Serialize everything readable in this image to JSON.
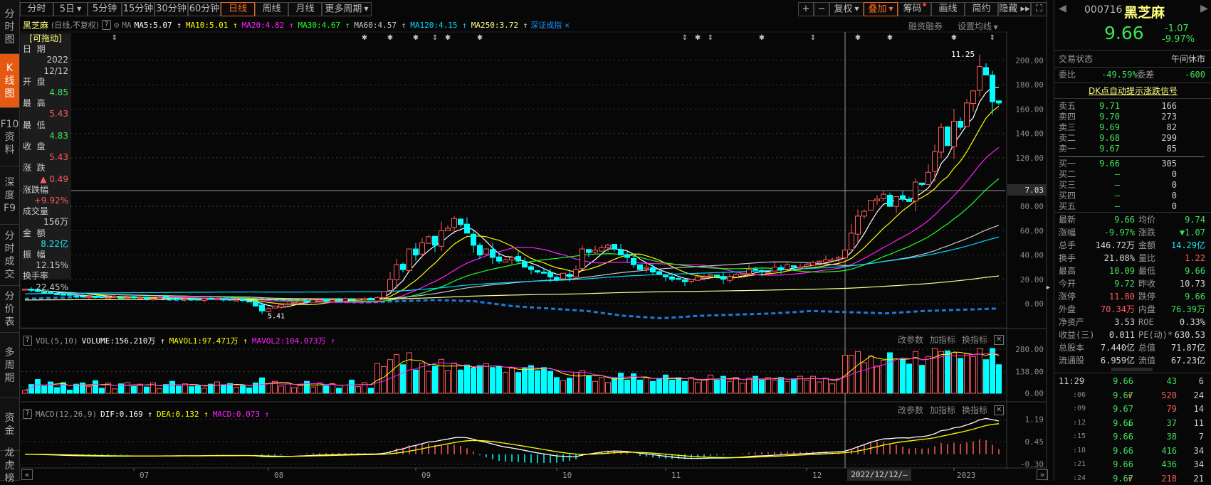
{
  "sidebar": {
    "items": [
      {
        "label": "分\n时\n图",
        "active": false
      },
      {
        "label": "K\n线\n图",
        "active": true
      },
      {
        "label": "F10\n资\n料",
        "active": false
      },
      {
        "label": "深\n度\nF9",
        "active": false
      },
      {
        "label": "分\n时\n成\n交",
        "active": false
      },
      {
        "label": "分\n价\n表",
        "active": false
      },
      {
        "label": "多\n周\n期",
        "active": false
      },
      {
        "label": "资\n金",
        "active": false
      },
      {
        "label": "龙\n虎\n榜",
        "active": false
      }
    ]
  },
  "toolbar": {
    "periods": [
      {
        "label": "分时"
      },
      {
        "label": "5日",
        "dropdown": true
      },
      {
        "label": "5分钟"
      },
      {
        "label": "15分钟"
      },
      {
        "label": "30分钟"
      },
      {
        "label": "60分钟"
      },
      {
        "label": "日线",
        "active": true
      },
      {
        "label": "周线"
      },
      {
        "label": "月线"
      },
      {
        "label": "更多周期",
        "dropdown": true
      }
    ],
    "tools": [
      {
        "label": "+"
      },
      {
        "label": "−"
      },
      {
        "label": "复权",
        "dropdown": true
      },
      {
        "label": "叠加",
        "dropdown": true,
        "active": true
      },
      {
        "label": "筹码",
        "dot": true
      },
      {
        "label": "画线"
      },
      {
        "label": "简约"
      },
      {
        "label": "隐藏 ▸▸"
      },
      {
        "label": "⛶"
      }
    ]
  },
  "legend": {
    "name": "黑芝麻",
    "mode": "(日线,不复权)",
    "help": "?",
    "ma_label": "MA",
    "mas": [
      {
        "text": "MA5:5.07",
        "color": "#ffffff"
      },
      {
        "text": "MA10:5.01",
        "color": "#ffff00"
      },
      {
        "text": "MA20:4.82",
        "color": "#ff20ff"
      },
      {
        "text": "MA30:4.67",
        "color": "#20ff20"
      },
      {
        "text": "MA60:4.57",
        "color": "#c8c8c8"
      },
      {
        "text": "MA120:4.15",
        "color": "#00d8ff"
      },
      {
        "text": "MA250:3.72",
        "color": "#ffff90"
      }
    ],
    "overlay": "深证成指",
    "overlay_close": "✕",
    "margin_label": "融资融券",
    "set_ma_label": "设置均线"
  },
  "infobox": {
    "drag": "[可拖动]",
    "rows": [
      {
        "l": "日  期"
      },
      {
        "v": "2022",
        "c": "#ccc"
      },
      {
        "v": "12/12",
        "c": "#ccc"
      },
      {
        "l": "开  盘"
      },
      {
        "v": "4.85",
        "c": "#3ee05a"
      },
      {
        "l": "最  高"
      },
      {
        "v": "5.43",
        "c": "#ff5a5a"
      },
      {
        "l": "最  低"
      },
      {
        "v": "4.83",
        "c": "#3ee05a"
      },
      {
        "l": "收  盘"
      },
      {
        "v": "5.43",
        "c": "#ff5a5a"
      },
      {
        "l": "涨  跌"
      },
      {
        "v": "▲ 0.49",
        "c": "#ff5a5a"
      },
      {
        "l": "涨跌幅"
      },
      {
        "v": "+9.92%",
        "c": "#ff5a5a"
      },
      {
        "l": "成交量"
      },
      {
        "v": "156万",
        "c": "#ccc"
      },
      {
        "l": "金  额"
      },
      {
        "v": "8.22亿",
        "c": "#19e6f0"
      },
      {
        "l": "振  幅"
      },
      {
        "v": "12.15%",
        "c": "#ccc"
      },
      {
        "l": "换手率"
      },
      {
        "v": "22.45%",
        "c": "#ccc"
      }
    ]
  },
  "chart_data": {
    "type": "candlestick",
    "price_axis": {
      "ticks": [
        "200.00",
        "180.00",
        "160.00",
        "140.00",
        "120.00",
        "7.03",
        "80.00",
        "60.00",
        "40.00",
        "20.00",
        "0.00"
      ],
      "tick_values": [
        200,
        180,
        160,
        140,
        120,
        null,
        80,
        60,
        40,
        20,
        0
      ],
      "range": [
        -15,
        210
      ],
      "crosshair_value": 7.03,
      "crosshair_label": "7.03"
    },
    "high_annotation": "11.25",
    "low_annotation": "5.41",
    "colors": {
      "up": "#ff5a5a",
      "down": "#00ffff",
      "ma5": "#ffffff",
      "ma10": "#ffff00",
      "ma20": "#ff20ff",
      "ma30": "#20ff20",
      "ma60": "#c8c8c8",
      "ma120": "#00d8ff",
      "ma250": "#ffff90",
      "index": "#1e78d8"
    },
    "close": [
      12,
      11,
      10,
      9,
      9,
      8,
      7,
      7,
      6,
      6,
      6,
      5,
      5,
      5,
      6,
      5,
      5,
      5,
      5,
      4,
      4,
      5,
      5,
      4,
      4,
      4,
      3,
      3,
      4,
      4,
      4,
      3,
      3,
      3,
      3,
      2,
      -2,
      -6,
      -4,
      -2,
      -1,
      0,
      1,
      2,
      2,
      3,
      3,
      2,
      3,
      3,
      4,
      3,
      4,
      4,
      3,
      5,
      10,
      20,
      32,
      28,
      45,
      40,
      50,
      55,
      48,
      60,
      62,
      70,
      65,
      58,
      48,
      40,
      45,
      38,
      35,
      36,
      38,
      35,
      30,
      28,
      26,
      25,
      22,
      20,
      25,
      22,
      28,
      45,
      42,
      44,
      46,
      48,
      45,
      40,
      38,
      32,
      28,
      30,
      26,
      24,
      22,
      20,
      20,
      18,
      20,
      22,
      22,
      24,
      22,
      20,
      22,
      24,
      25,
      28,
      28,
      26,
      26,
      30,
      28,
      32,
      30,
      30,
      32,
      34,
      35,
      36,
      36,
      38,
      44,
      58,
      72,
      76,
      85,
      86,
      90,
      80,
      88,
      86,
      84,
      100,
      98,
      108,
      125,
      145,
      130,
      150,
      145,
      165,
      175,
      195,
      188,
      166,
      165
    ],
    "index_overlay": [
      4,
      5,
      6,
      5,
      3,
      4,
      4,
      3,
      2,
      1,
      2,
      3,
      2,
      -2,
      -4,
      -6,
      -10,
      -12,
      -10,
      -9,
      -8,
      -6,
      -7,
      -8,
      -6,
      -5,
      -4
    ],
    "markers": [
      {
        "i": 14,
        "t": "⇕"
      },
      {
        "i": 64,
        "t": "⇕"
      },
      {
        "i": 53,
        "t": "✱"
      },
      {
        "i": 57,
        "t": "✱"
      },
      {
        "i": 61,
        "t": "✱"
      },
      {
        "i": 66,
        "t": "✱"
      },
      {
        "i": 71,
        "t": "✱"
      },
      {
        "i": 103,
        "t": "⇕"
      },
      {
        "i": 105,
        "t": "✱"
      },
      {
        "i": 107,
        "t": "⇕"
      },
      {
        "i": 115,
        "t": "✱"
      },
      {
        "i": 123,
        "t": "⇕"
      },
      {
        "i": 130,
        "t": "✱"
      },
      {
        "i": 135,
        "t": "✱"
      },
      {
        "i": 145,
        "t": "✱"
      },
      {
        "i": 151,
        "t": "⇕"
      }
    ],
    "selected_index": 128,
    "x_labels": [
      {
        "i": 17,
        "t": "07"
      },
      {
        "i": 38,
        "t": "08"
      },
      {
        "i": 61,
        "t": "09"
      },
      {
        "i": 83,
        "t": "10"
      },
      {
        "i": 100,
        "t": "11"
      },
      {
        "i": 122,
        "t": "12"
      },
      {
        "i": 145,
        "t": "2023"
      }
    ],
    "selected_date": "2022/12/12/—"
  },
  "volume_panel": {
    "title": "VOL(5,10)",
    "values": [
      {
        "text": "VOLUME:156.210万",
        "color": "#ffffff"
      },
      {
        "text": "MAVOL1:97.471万",
        "color": "#ffff00"
      },
      {
        "text": "MAVOL2:104.073万",
        "color": "#ff20ff"
      }
    ],
    "buttons": [
      "改参数",
      "加指标",
      "换指标"
    ],
    "ticks": [
      "280.00",
      "138.00",
      "0.00"
    ],
    "tick_values": [
      280,
      138,
      0
    ]
  },
  "macd_panel": {
    "title": "MACD(12,26,9)",
    "values": [
      {
        "text": "DIF:0.169",
        "color": "#ffffff"
      },
      {
        "text": "DEA:0.132",
        "color": "#ffff00"
      },
      {
        "text": "MACD:0.073",
        "color": "#ff20ff"
      }
    ],
    "buttons": [
      "改参数",
      "加指标",
      "换指标"
    ],
    "ticks": [
      "1.19",
      "0.45",
      "-0.30"
    ],
    "tick_values": [
      1.19,
      0.45,
      -0.3
    ]
  },
  "quote": {
    "code": "000716",
    "name": "黑芝麻",
    "price": "9.66",
    "change": "-1.07",
    "pct": "-9.97%",
    "status_label": "交易状态",
    "status": "午间休市",
    "wb_label": "委比",
    "wb": "-49.59%",
    "wc_label": "委差",
    "wc": "-600",
    "dk_link": "DK点自动提示涨跌信号",
    "asks": [
      {
        "l": "卖五",
        "p": "9.71",
        "v": "166"
      },
      {
        "l": "卖四",
        "p": "9.70",
        "v": "273"
      },
      {
        "l": "卖三",
        "p": "9.69",
        "v": "82"
      },
      {
        "l": "卖二",
        "p": "9.68",
        "v": "299"
      },
      {
        "l": "卖一",
        "p": "9.67",
        "v": "85"
      }
    ],
    "bids": [
      {
        "l": "买一",
        "p": "9.66",
        "v": "305"
      },
      {
        "l": "买二",
        "p": "—",
        "v": "0"
      },
      {
        "l": "买三",
        "p": "—",
        "v": "0"
      },
      {
        "l": "买四",
        "p": "—",
        "v": "0"
      },
      {
        "l": "买五",
        "p": "—",
        "v": "0"
      }
    ],
    "stats": [
      [
        "最新",
        "9.66",
        "g",
        "均价",
        "9.74",
        "g"
      ],
      [
        "涨幅",
        "-9.97%",
        "g",
        "涨跌",
        "▼1.07",
        "g"
      ],
      [
        "总手",
        "146.72万",
        "w",
        "金额",
        "14.29亿",
        "c"
      ],
      [
        "换手",
        "21.08%",
        "w",
        "量比",
        "1.22",
        "r"
      ],
      [
        "最高",
        "10.09",
        "g",
        "最低",
        "9.66",
        "g"
      ],
      [
        "今开",
        "9.72",
        "g",
        "昨收",
        "10.73",
        "w"
      ],
      [
        "涨停",
        "11.80",
        "r",
        "跌停",
        "9.66",
        "g"
      ],
      [
        "外盘",
        "70.34万",
        "r",
        "内盘",
        "76.39万",
        "g"
      ],
      [
        "净资产",
        "3.53",
        "w",
        "ROE",
        "0.33%",
        "w"
      ],
      [
        "收益(三)",
        "0.011",
        "w",
        "PE(动)*",
        "630.53",
        "w"
      ],
      [
        "总股本",
        "7.440亿",
        "w",
        "总值",
        "71.87亿",
        "w"
      ],
      [
        "流通股",
        "6.959亿",
        "w",
        "流值",
        "67.23亿",
        "w"
      ]
    ],
    "ticks": [
      {
        "t": "11:29",
        "p": "9.66",
        "d": "",
        "v": "43",
        "vc": "g",
        "n": "6"
      },
      {
        "t": ":06",
        "p": "9.67",
        "d": "↑",
        "v": "520",
        "vc": "r",
        "n": "24"
      },
      {
        "t": ":09",
        "p": "9.67",
        "d": "",
        "v": "79",
        "vc": "r",
        "n": "14"
      },
      {
        "t": ":12",
        "p": "9.66",
        "d": "↓",
        "v": "37",
        "vc": "g",
        "n": "11"
      },
      {
        "t": ":15",
        "p": "9.66",
        "d": "",
        "v": "38",
        "vc": "g",
        "n": "7"
      },
      {
        "t": ":18",
        "p": "9.66",
        "d": "",
        "v": "416",
        "vc": "g",
        "n": "34"
      },
      {
        "t": ":21",
        "p": "9.66",
        "d": "",
        "v": "436",
        "vc": "g",
        "n": "34"
      },
      {
        "t": ":24",
        "p": "9.67",
        "d": "↑",
        "v": "218",
        "vc": "r",
        "n": "21"
      }
    ]
  }
}
